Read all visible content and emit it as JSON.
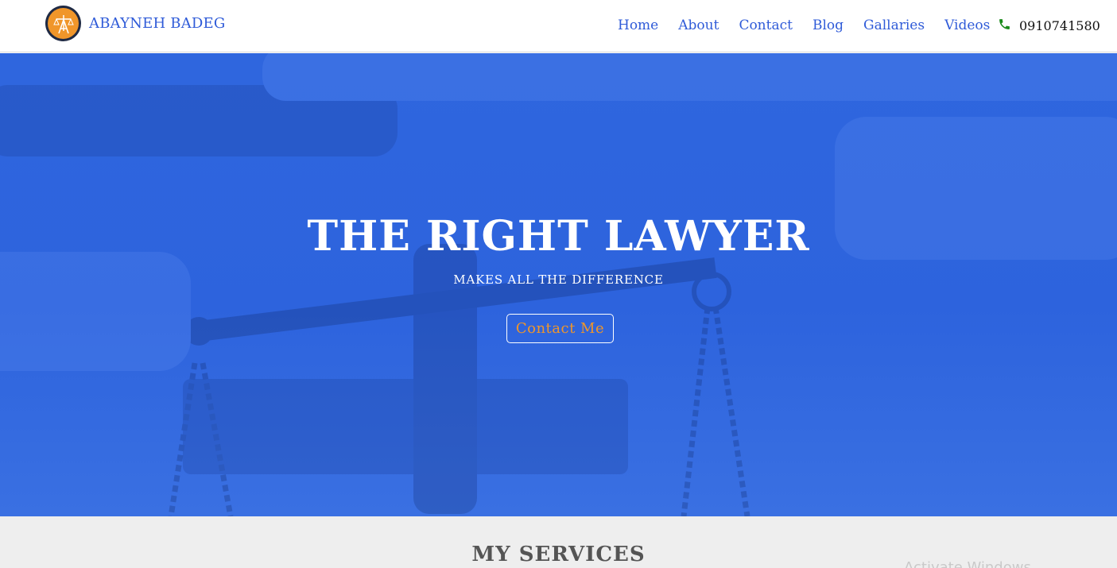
{
  "header": {
    "brand": "ABAYNEH BADEG",
    "logo_icon": "scales-of-justice-logo-icon",
    "nav": [
      {
        "label": "Home"
      },
      {
        "label": "About"
      },
      {
        "label": "Contact"
      },
      {
        "label": "Blog"
      },
      {
        "label": "Gallaries"
      },
      {
        "label": "Videos"
      }
    ],
    "phone_icon": "phone-icon",
    "phone": "0910741580"
  },
  "hero": {
    "title": "THE RIGHT LAWYER",
    "subtitle": "MAKES ALL THE DIFFERENCE",
    "cta": "Contact Me"
  },
  "services": {
    "title": "MY SERVICES"
  },
  "system": {
    "watermark": "Activate Windows"
  },
  "colors": {
    "brand_blue": "#2f5bd8",
    "hero_blue": "#2f66de",
    "accent_orange": "#f0962a",
    "phone_green": "#1a8a1a"
  }
}
